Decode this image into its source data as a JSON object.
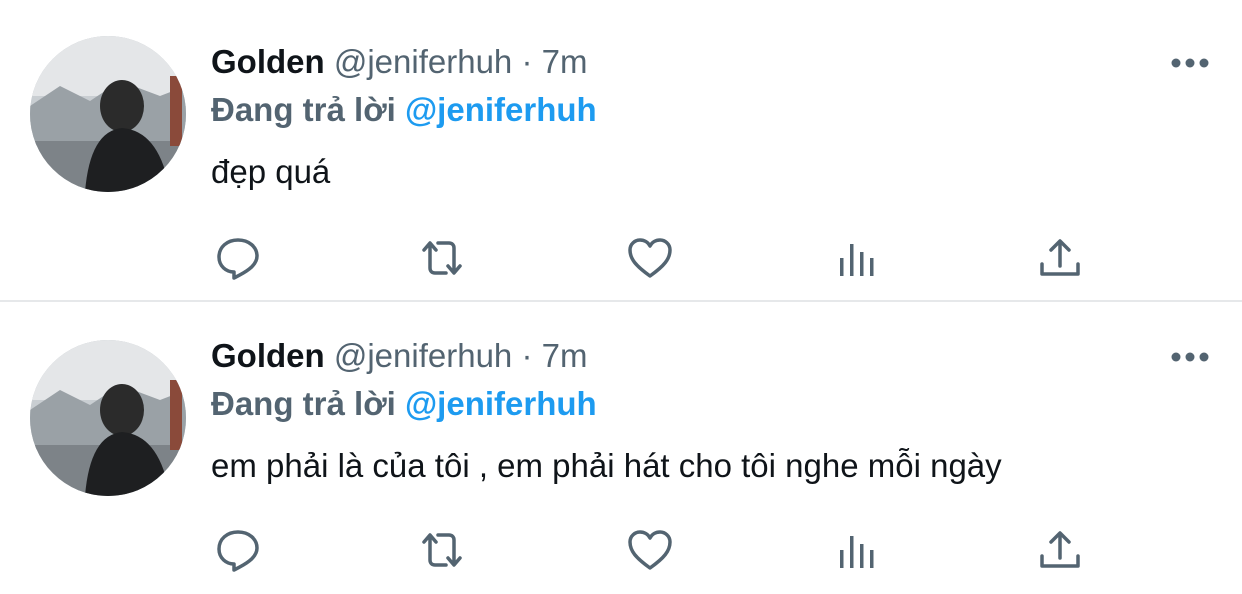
{
  "tweets": [
    {
      "name": "Golden",
      "handle": "@jeniferhuh",
      "dot": "·",
      "time": "7m",
      "reply_prefix": "Đang trả lời",
      "reply_to": "@jeniferhuh",
      "text": "đẹp quá"
    },
    {
      "name": "Golden",
      "handle": "@jeniferhuh",
      "dot": "·",
      "time": "7m",
      "reply_prefix": "Đang trả lời",
      "reply_to": "@jeniferhuh",
      "text": "em phải là của tôi , em phải hát cho tôi nghe mỗi ngày"
    }
  ],
  "icons": {
    "more": "more-icon",
    "reply": "reply-icon",
    "retweet": "retweet-icon",
    "like": "like-icon",
    "analytics": "analytics-icon",
    "share": "share-icon"
  },
  "colors": {
    "text": "#0f1419",
    "secondary": "#536471",
    "accent": "#1d9bf0",
    "divider": "#e6e8ea"
  }
}
